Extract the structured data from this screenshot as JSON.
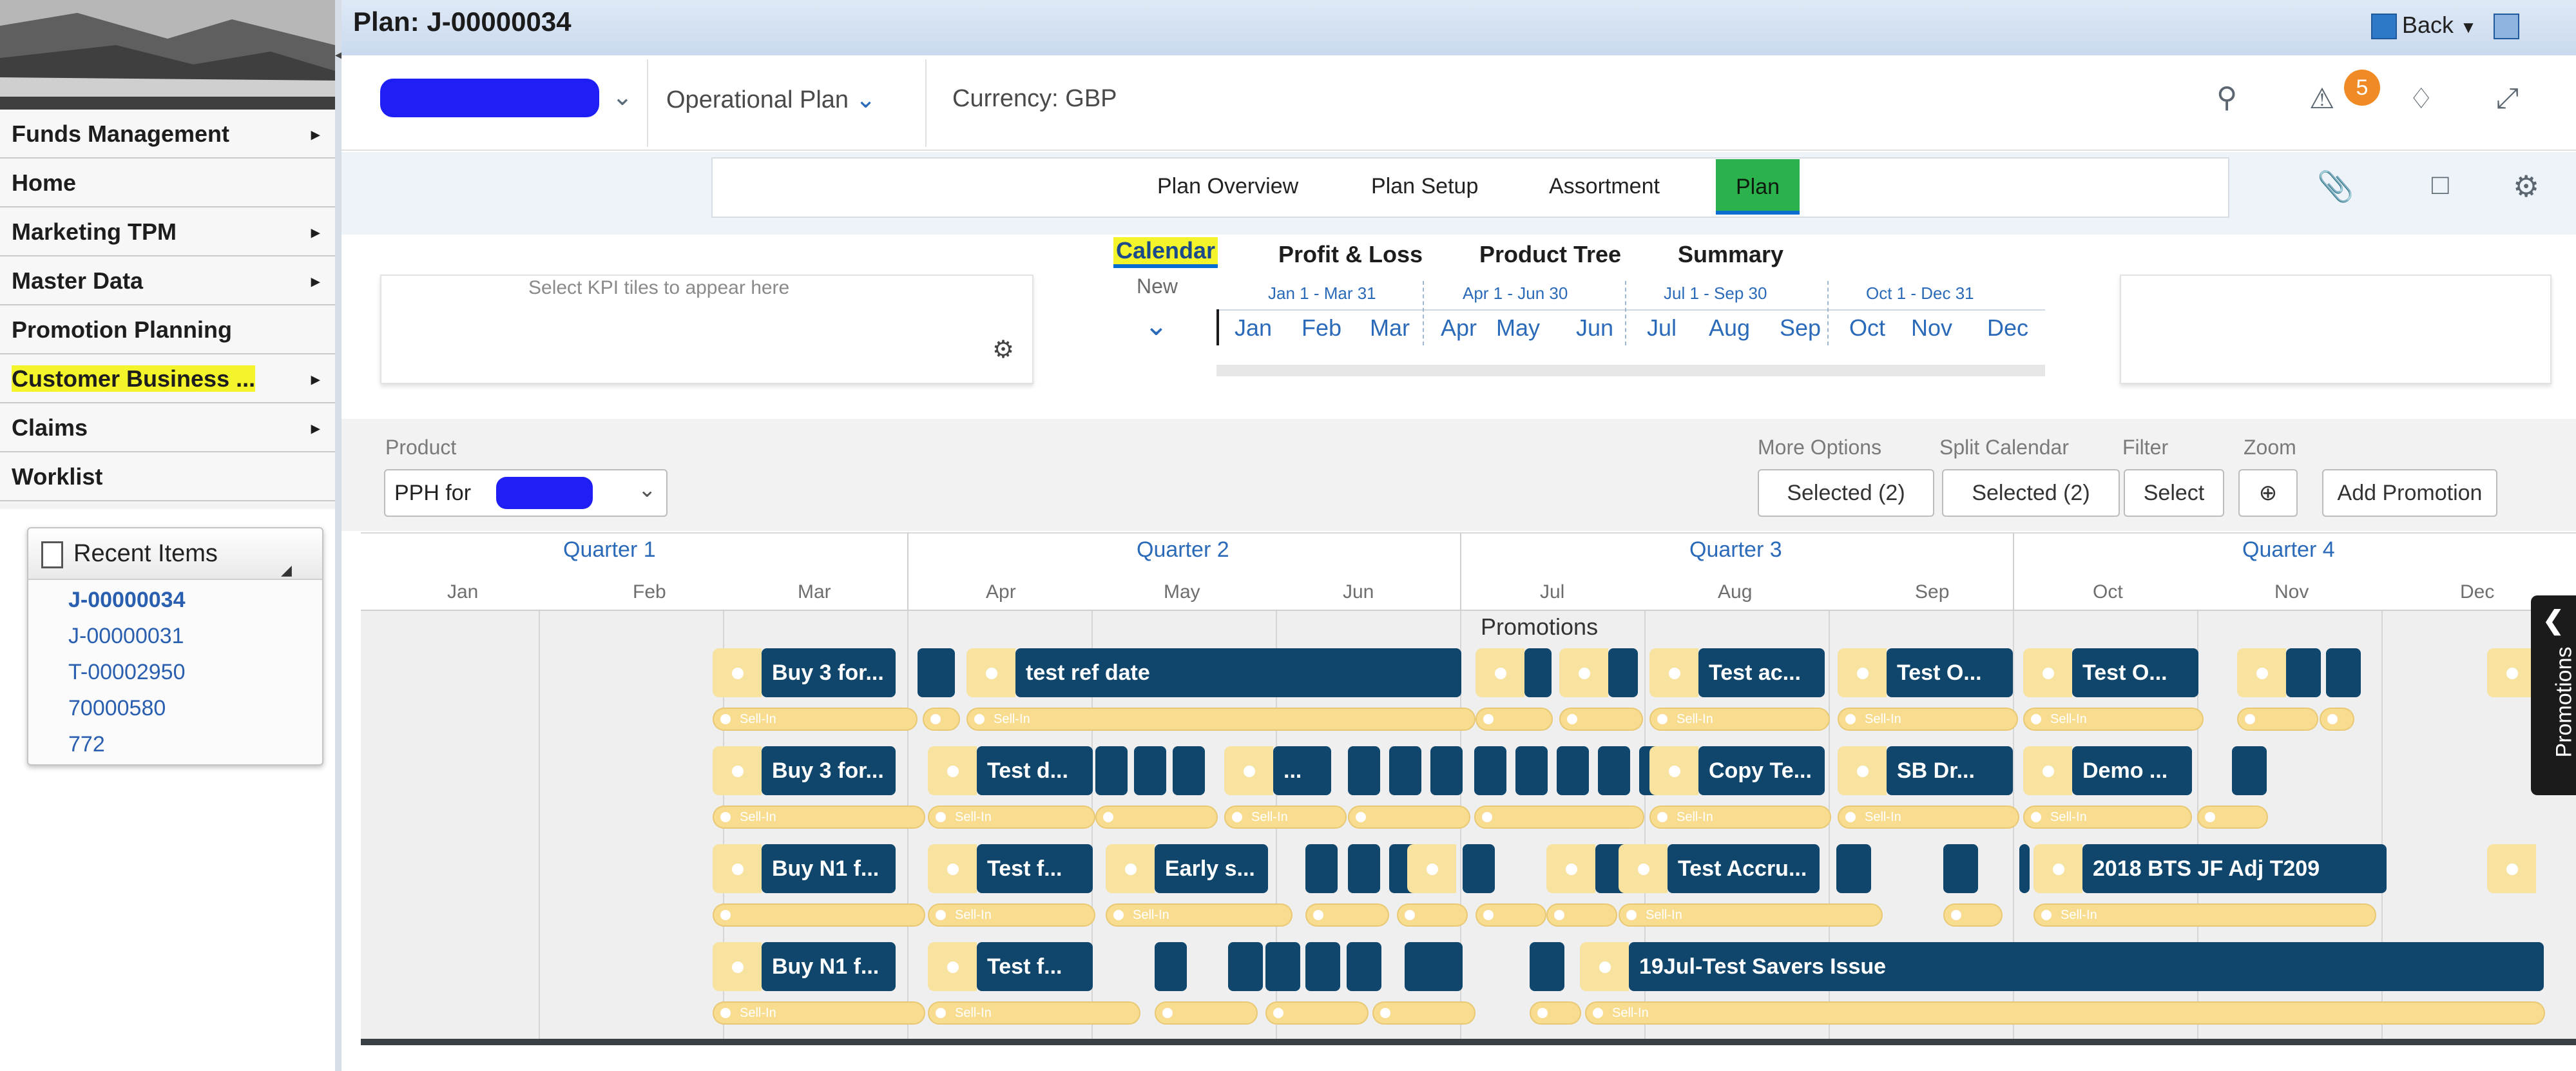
{
  "nav": {
    "items": [
      {
        "label": "Funds Management",
        "arrow": "▸"
      },
      {
        "label": "Home",
        "arrow": ""
      },
      {
        "label": "Marketing TPM",
        "arrow": "▸"
      },
      {
        "label": "Master Data",
        "arrow": "▸"
      },
      {
        "label": "Promotion Planning",
        "arrow": ""
      },
      {
        "label": "Customer Business ...",
        "arrow": "▸"
      },
      {
        "label": "Claims",
        "arrow": "▸"
      },
      {
        "label": "Worklist",
        "arrow": ""
      }
    ],
    "recent": {
      "title": "Recent Items",
      "items": [
        "J-00000034",
        "J-00000031",
        "T-00002950",
        "70000580",
        "772"
      ]
    }
  },
  "header": {
    "title": "Plan: J-00000034",
    "back_label": "Back",
    "view_label": "Operational Plan",
    "currency": "Currency: GBP",
    "alert_count": "5"
  },
  "tabs": [
    "Plan Overview",
    "Plan Setup",
    "Assortment",
    "Plan"
  ],
  "subtabs": [
    "Calendar",
    "Profit & Loss",
    "Product Tree",
    "Summary"
  ],
  "kpi": {
    "hint": "Select KPI tiles to appear here"
  },
  "timeline": {
    "view_label": "New",
    "quarters": [
      "Jan 1 - Mar 31",
      "Apr 1 - Jun 30",
      "Jul 1 - Sep 30",
      "Oct 1 - Dec 31"
    ],
    "months": [
      "Jan",
      "Feb",
      "Mar",
      "Apr",
      "May",
      "Jun",
      "Jul",
      "Aug",
      "Sep",
      "Oct",
      "Nov",
      "Dec"
    ]
  },
  "filters": {
    "product_label": "Product",
    "product_value": "PPH for",
    "more_options": {
      "label": "More Options",
      "value": "Selected (2)"
    },
    "split_calendar": {
      "label": "Split Calendar",
      "value": "Selected (2)"
    },
    "filter": {
      "label": "Filter",
      "value": "Select"
    },
    "zoom": {
      "label": "Zoom"
    },
    "add_promotion": "Add Promotion"
  },
  "calendar": {
    "quarters": [
      "Quarter 1",
      "Quarter 2",
      "Quarter 3",
      "Quarter 4"
    ],
    "months": [
      "Jan",
      "Feb",
      "Mar",
      "Apr",
      "May",
      "Jun",
      "Jul",
      "Aug",
      "Sep",
      "Oct",
      "Nov",
      "Dec"
    ],
    "promotions_label": "Promotions",
    "side_tab": "Promotions",
    "sellin_label": "Sell-In",
    "promos": [
      "Buy 3 for...",
      "test ref date",
      "Test ac...",
      "Test O...",
      "Test O...",
      "Buy 3 for...",
      "Test d...",
      "...",
      "Copy Te...",
      "SB Dr...",
      "Demo ...",
      "Buy N1 f...",
      "Test f...",
      "Early s...",
      "Test Accru...",
      "2018 BTS JF Adj T209",
      "Buy N1 f...",
      "Test f...",
      "19Jul-Test Savers Issue"
    ]
  }
}
